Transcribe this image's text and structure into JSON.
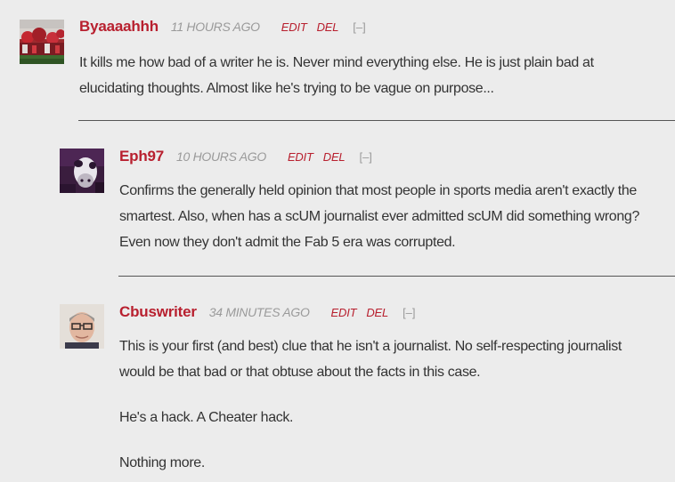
{
  "comments": [
    {
      "author": "Byaaaahhh",
      "time": "11 HOURS AGO",
      "edit_label": "EDIT",
      "del_label": "DEL",
      "collapse_label": "[–]",
      "paragraphs": [
        "It kills me how bad of a writer he is. Never mind everything else. He is just plain bad at elucidating thoughts. Almost like he's trying to be vague on purpose..."
      ]
    },
    {
      "author": "Eph97",
      "time": "10 HOURS AGO",
      "edit_label": "EDIT",
      "del_label": "DEL",
      "collapse_label": "[–]",
      "paragraphs": [
        "Confirms the generally held opinion that most people in sports media aren't exactly the smartest. Also, when has a scUM journalist ever admitted scUM did something wrong? Even now they don't admit the Fab 5 era was corrupted."
      ]
    },
    {
      "author": "Cbuswriter",
      "time": "34 MINUTES AGO",
      "edit_label": "EDIT",
      "del_label": "DEL",
      "collapse_label": "[–]",
      "paragraphs": [
        "This is your first (and best) clue that he isn't a journalist. No self-respecting journalist would be that bad or that obtuse about the facts in this case.",
        "He's a hack. A Cheater hack.",
        "Nothing more."
      ]
    }
  ],
  "colors": {
    "background": "#ececec",
    "author": "#b8202f",
    "action": "#b8202f",
    "meta": "#9a9a9a",
    "text": "#333333",
    "divider": "#555555"
  }
}
